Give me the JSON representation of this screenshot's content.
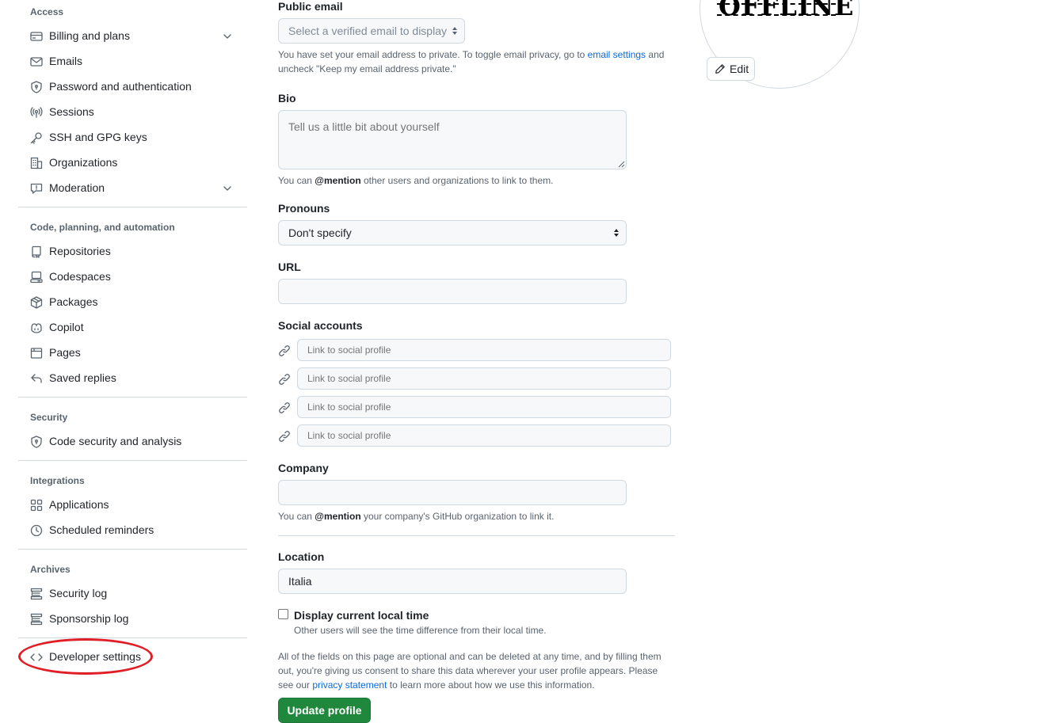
{
  "sidebar": {
    "sections": {
      "access": "Access",
      "code": "Code, planning, and automation",
      "security": "Security",
      "integrations": "Integrations",
      "archives": "Archives"
    },
    "items": {
      "billing": "Billing and plans",
      "emails": "Emails",
      "password": "Password and authentication",
      "sessions": "Sessions",
      "ssh": "SSH and GPG keys",
      "organizations": "Organizations",
      "moderation": "Moderation",
      "repositories": "Repositories",
      "codespaces": "Codespaces",
      "packages": "Packages",
      "copilot": "Copilot",
      "pages": "Pages",
      "saved_replies": "Saved replies",
      "code_security": "Code security and analysis",
      "applications": "Applications",
      "scheduled_reminders": "Scheduled reminders",
      "security_log": "Security log",
      "sponsorship_log": "Sponsorship log",
      "developer_settings": "Developer settings"
    },
    "annotation_color": "#e01e26"
  },
  "form": {
    "public_email": {
      "label": "Public email",
      "value": "Select a verified email to display",
      "note_before": "You have set your email address to private. To toggle email privacy, go to",
      "note_link": "email settings",
      "note_after": "and uncheck \"Keep my email address private.\""
    },
    "bio": {
      "label": "Bio",
      "placeholder": "Tell us a little bit about yourself",
      "note_before": "You can",
      "note_bold": "@mention",
      "note_after": "other users and organizations to link to them."
    },
    "pronouns": {
      "label": "Pronouns",
      "value": "Don't specify"
    },
    "url": {
      "label": "URL",
      "value": ""
    },
    "social": {
      "label": "Social accounts",
      "placeholder": "Link to social profile"
    },
    "company": {
      "label": "Company",
      "value": "",
      "note_before": "You can",
      "note_bold": "@mention",
      "note_after": "your company's GitHub organization to link it."
    },
    "location": {
      "label": "Location",
      "value": "Italia"
    },
    "local_time": {
      "label": "Display current local time",
      "note": "Other users will see the time difference from their local time.",
      "checked": false
    },
    "footer": {
      "before": "All of the fields on this page are optional and can be deleted at any time, and by filling them out, you're giving us consent to share this data wherever your user profile appears. Please see our",
      "link": "privacy statement",
      "after": "to learn more about how we use this information."
    },
    "update_button": "Update profile"
  },
  "avatar": {
    "text": "OFFLINE",
    "edit_label": "Edit"
  },
  "colors": {
    "accent_link": "#0969da",
    "primary_button": "#1f883d",
    "muted_text": "#59636e",
    "border": "#d1d9e0"
  }
}
